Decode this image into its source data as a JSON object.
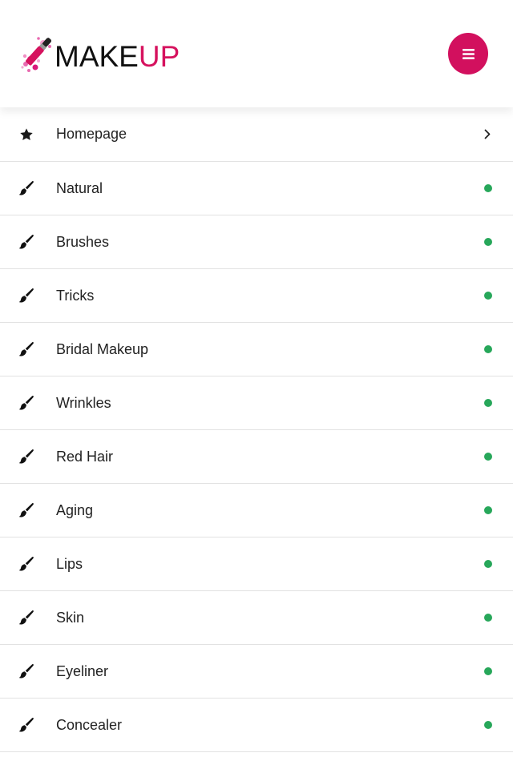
{
  "header": {
    "logo_text_main": "MAKE",
    "logo_text_accent": "UP",
    "menu_icon": "hamburger-icon",
    "brand_color": "#d2105e"
  },
  "nav": {
    "items": [
      {
        "label": "Homepage",
        "icon": "star-icon",
        "indicator": "chevron-right-icon"
      },
      {
        "label": "Natural",
        "icon": "brush-icon",
        "indicator": "status-dot"
      },
      {
        "label": "Brushes",
        "icon": "brush-icon",
        "indicator": "status-dot"
      },
      {
        "label": "Tricks",
        "icon": "brush-icon",
        "indicator": "status-dot"
      },
      {
        "label": "Bridal Makeup",
        "icon": "brush-icon",
        "indicator": "status-dot"
      },
      {
        "label": "Wrinkles",
        "icon": "brush-icon",
        "indicator": "status-dot"
      },
      {
        "label": "Red Hair",
        "icon": "brush-icon",
        "indicator": "status-dot"
      },
      {
        "label": "Aging",
        "icon": "brush-icon",
        "indicator": "status-dot"
      },
      {
        "label": "Lips",
        "icon": "brush-icon",
        "indicator": "status-dot"
      },
      {
        "label": "Skin",
        "icon": "brush-icon",
        "indicator": "status-dot"
      },
      {
        "label": "Eyeliner",
        "icon": "brush-icon",
        "indicator": "status-dot"
      },
      {
        "label": "Concealer",
        "icon": "brush-icon",
        "indicator": "status-dot"
      }
    ],
    "dot_color": "#27a75a"
  }
}
